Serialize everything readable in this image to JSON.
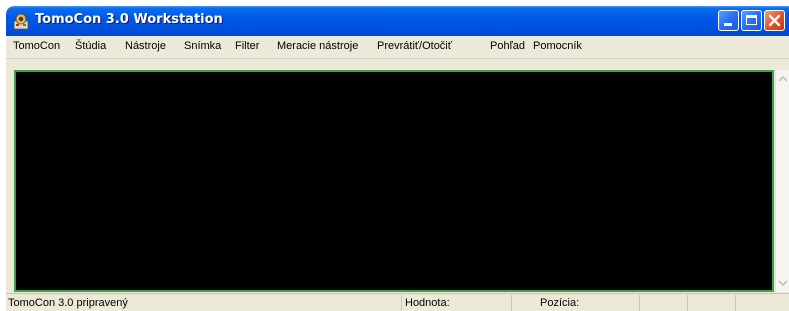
{
  "window": {
    "title": "TomoCon 3.0 Workstation"
  },
  "menu": {
    "items": [
      {
        "label": "TomoCon"
      },
      {
        "label": "Štúdia"
      },
      {
        "label": "Nástroje"
      },
      {
        "label": "Snímka"
      },
      {
        "label": "Filter"
      },
      {
        "label": "Meracie nástroje"
      },
      {
        "label": "Prevrátiť/Otočiť"
      },
      {
        "label": "Pohľad"
      },
      {
        "label": "Pomocník"
      }
    ]
  },
  "statusbar": {
    "message": "TomoCon 3.0 pripravený",
    "value_label": "Hodnota:",
    "position_label": "Pozícia:"
  },
  "colors": {
    "titlebar": "#0055e5",
    "viewport_background": "#000000",
    "viewport_border": "#3aa34a",
    "close_button": "#e1552e"
  },
  "icons": {
    "app": "tomocon-app-icon",
    "minimize": "minimize-icon",
    "maximize": "maximize-icon",
    "close": "close-icon",
    "scroll_up": "chevron-up-icon",
    "scroll_down": "chevron-down-icon"
  }
}
